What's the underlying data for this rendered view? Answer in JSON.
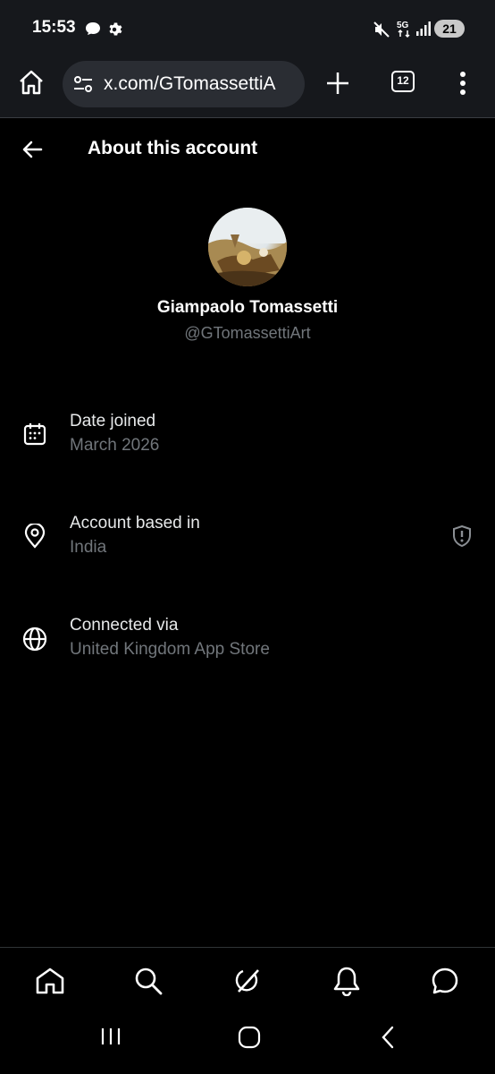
{
  "status_bar": {
    "time": "15:53",
    "network": "5G",
    "battery": "21"
  },
  "browser": {
    "url": "x.com/GTomassettiA",
    "tab_count": "12"
  },
  "header": {
    "title": "About this account"
  },
  "profile": {
    "name": "Giampaolo Tomassetti",
    "handle": "@GTomassettiArt"
  },
  "details": [
    {
      "label": "Date joined",
      "value": "March 2026",
      "icon": "calendar-icon"
    },
    {
      "label": "Account based in",
      "value": "India",
      "icon": "location-pin-icon"
    },
    {
      "label": "Connected via",
      "value": "United Kingdom App Store",
      "icon": "globe-icon"
    }
  ],
  "bottom_nav": [
    "home-icon",
    "search-icon",
    "grok-icon",
    "notifications-icon",
    "messages-icon"
  ],
  "colors": {
    "background": "#000000",
    "bar": "#16181c",
    "primary_text": "#e7e9ea",
    "secondary_text": "#71767b"
  }
}
